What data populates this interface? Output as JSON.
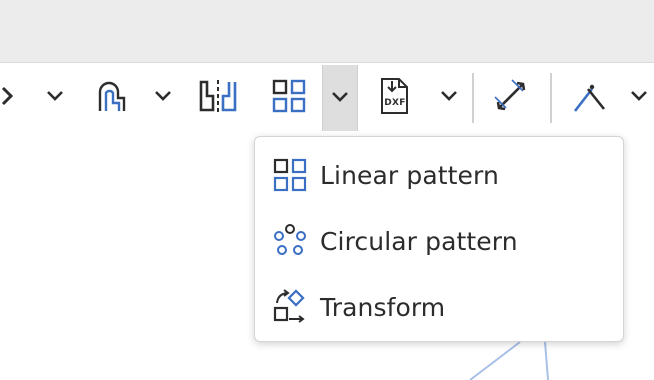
{
  "colors": {
    "accent": "#3a6fc4",
    "icon_dark": "#2d2d2d",
    "menu_text": "#2c2c2c",
    "topbar": "#ececec",
    "active_dropdown_bg": "#dedede"
  },
  "toolbar": {
    "items": [
      {
        "icon": "partial-tool-icon"
      },
      {
        "icon": "chevron-down-icon"
      },
      {
        "icon": "offset-sketch-icon"
      },
      {
        "icon": "chevron-down-icon"
      },
      {
        "icon": "mirror-icon"
      },
      {
        "icon": "linear-pattern-icon"
      },
      {
        "icon": "chevron-down-icon"
      },
      {
        "icon": "dxf-import-icon",
        "text": "DXF"
      },
      {
        "icon": "chevron-down-icon"
      },
      {
        "icon": "dimension-icon"
      },
      {
        "icon": "construction-line-icon"
      },
      {
        "icon": "chevron-down-icon"
      }
    ]
  },
  "pattern_menu": {
    "items": [
      {
        "label": "Linear pattern",
        "icon": "linear-pattern-icon"
      },
      {
        "label": "Circular pattern",
        "icon": "circular-pattern-icon"
      },
      {
        "label": "Transform",
        "icon": "transform-icon"
      }
    ]
  }
}
